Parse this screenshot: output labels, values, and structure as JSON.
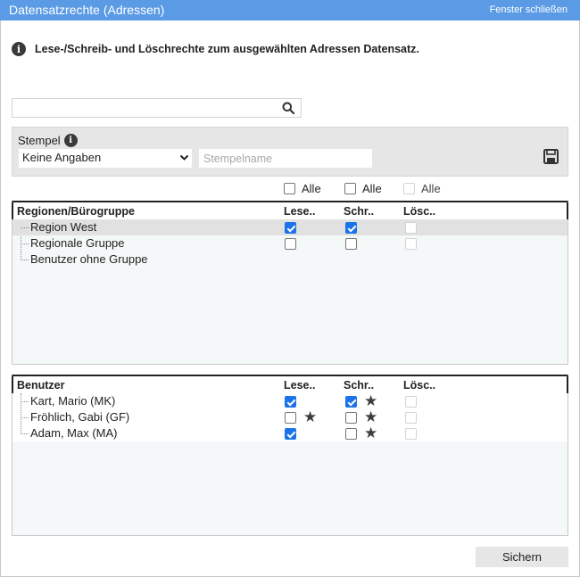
{
  "window": {
    "title": "Datensatzrechte (Adressen)",
    "close_label": "Fenster schließen",
    "colors": {
      "titlebar": "#5b9be6",
      "checkbox_checked": "#1a73e8",
      "panel": "#e6e6e6"
    }
  },
  "info": {
    "icon": "info-icon",
    "text": "Lese-/Schreib- und Löschrechte zum ausgewählten Adressen Datensatz."
  },
  "search": {
    "value": "",
    "placeholder": "",
    "icon": "search-icon"
  },
  "stempel": {
    "label": "Stempel",
    "select_value": "Keine Angaben",
    "name_placeholder": "Stempelname",
    "save_icon": "save-icon"
  },
  "alle": {
    "lesen": {
      "label": "Alle",
      "checked": false,
      "disabled": false
    },
    "schreiben": {
      "label": "Alle",
      "checked": false,
      "disabled": false
    },
    "loeschen": {
      "label": "Alle",
      "checked": false,
      "disabled": true
    }
  },
  "regions": {
    "columns": {
      "name": "Regionen/Bürogruppe",
      "lesen": "Lese..",
      "schreiben": "Schr..",
      "loeschen": "Lösc.."
    },
    "rows": [
      {
        "name": "Region West",
        "lesen": true,
        "schreiben": true,
        "loeschen": false,
        "selected": true
      },
      {
        "name": "Regionale Gruppe",
        "lesen": false,
        "schreiben": false,
        "loeschen": false
      },
      {
        "name": "Benutzer ohne Gruppe"
      }
    ]
  },
  "users": {
    "columns": {
      "name": "Benutzer",
      "lesen": "Lese..",
      "schreiben": "Schr..",
      "loeschen": "Lösc.."
    },
    "rows": [
      {
        "name": "Kart, Mario (MK)",
        "lesen": true,
        "lesen_star": false,
        "schreiben": true,
        "schreiben_star": true,
        "loeschen": false
      },
      {
        "name": "Fröhlich, Gabi (GF)",
        "lesen": false,
        "lesen_star": true,
        "schreiben": false,
        "schreiben_star": true,
        "loeschen": false
      },
      {
        "name": "Adam, Max (MA)",
        "lesen": true,
        "lesen_star": false,
        "schreiben": false,
        "schreiben_star": true,
        "loeschen": false
      }
    ]
  },
  "footer": {
    "save_label": "Sichern"
  }
}
